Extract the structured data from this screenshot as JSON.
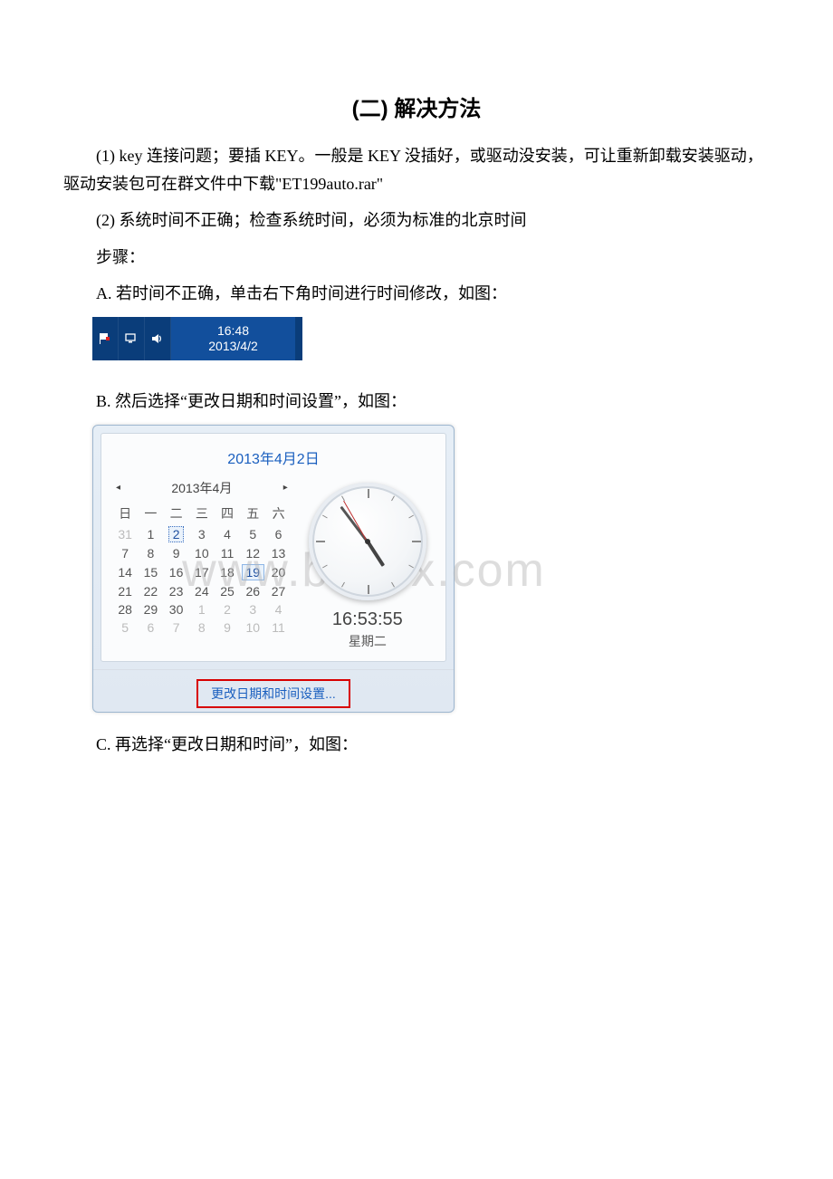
{
  "title": "(二) 解决方法",
  "p1": "(1) key 连接问题；要插 KEY。一般是 KEY 没插好，或驱动没安装，可让重新卸载安装驱动，驱动安装包可在群文件中下载\"ET199auto.rar\"",
  "p2": "(2) 系统时间不正确；检查系统时间，必须为标准的北京时间",
  "p3": "步骤：",
  "p4": "A. 若时间不正确，单击右下角时间进行时间修改，如图：",
  "p5": "B. 然后选择“更改日期和时间设置”，如图：",
  "p6": "C. 再选择“更改日期和时间”，如图：",
  "taskbar": {
    "time": "16:48",
    "date": "2013/4/2"
  },
  "popup": {
    "dateHeader": "2013年4月2日",
    "monthLabel": "2013年4月",
    "weekdays": [
      "日",
      "一",
      "二",
      "三",
      "四",
      "五",
      "六"
    ],
    "rows": [
      [
        {
          "d": "31",
          "o": true
        },
        {
          "d": "1"
        },
        {
          "d": "2",
          "today": true
        },
        {
          "d": "3"
        },
        {
          "d": "4"
        },
        {
          "d": "5"
        },
        {
          "d": "6"
        }
      ],
      [
        {
          "d": "7"
        },
        {
          "d": "8"
        },
        {
          "d": "9"
        },
        {
          "d": "10"
        },
        {
          "d": "11"
        },
        {
          "d": "12"
        },
        {
          "d": "13"
        }
      ],
      [
        {
          "d": "14"
        },
        {
          "d": "15"
        },
        {
          "d": "16"
        },
        {
          "d": "17"
        },
        {
          "d": "18"
        },
        {
          "d": "19",
          "marked": true
        },
        {
          "d": "20"
        }
      ],
      [
        {
          "d": "21"
        },
        {
          "d": "22"
        },
        {
          "d": "23"
        },
        {
          "d": "24"
        },
        {
          "d": "25"
        },
        {
          "d": "26"
        },
        {
          "d": "27"
        }
      ],
      [
        {
          "d": "28"
        },
        {
          "d": "29"
        },
        {
          "d": "30"
        },
        {
          "d": "1",
          "o": true
        },
        {
          "d": "2",
          "o": true
        },
        {
          "d": "3",
          "o": true
        },
        {
          "d": "4",
          "o": true
        }
      ],
      [
        {
          "d": "5",
          "o": true
        },
        {
          "d": "6",
          "o": true
        },
        {
          "d": "7",
          "o": true
        },
        {
          "d": "8",
          "o": true
        },
        {
          "d": "9",
          "o": true
        },
        {
          "d": "10",
          "o": true
        },
        {
          "d": "11",
          "o": true
        }
      ]
    ],
    "time": "16:53:55",
    "dow": "星期二",
    "changeLink": "更改日期和时间设置...",
    "navPrev": "◂",
    "navNext": "▸"
  },
  "watermark": "www.bdocx.com"
}
